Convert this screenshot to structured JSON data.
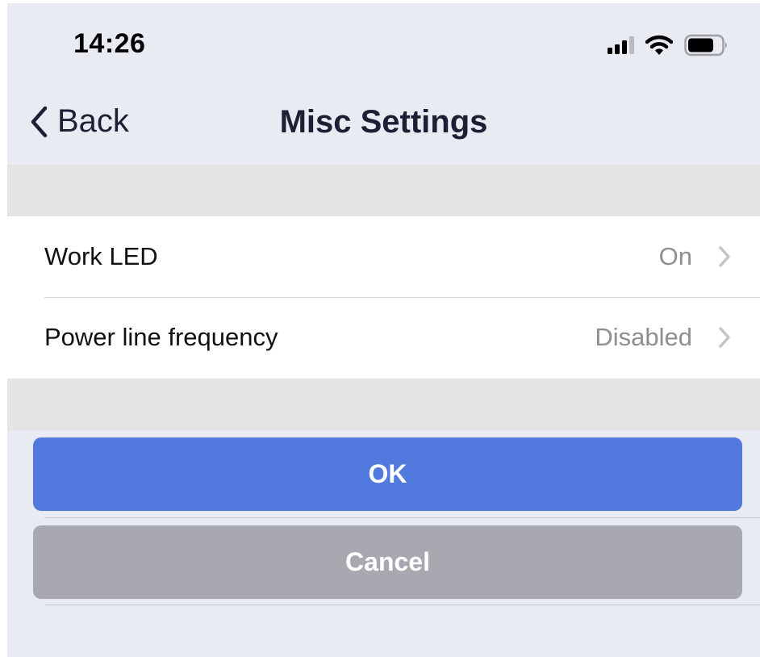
{
  "status_bar": {
    "time": "14:26",
    "icons": [
      "signal-icon",
      "wifi-icon",
      "battery-icon"
    ]
  },
  "nav": {
    "back_label": "Back",
    "title": "Misc Settings"
  },
  "settings": {
    "rows": [
      {
        "label": "Work LED",
        "value": "On"
      },
      {
        "label": "Power line frequency",
        "value": "Disabled"
      }
    ]
  },
  "actions": {
    "ok_label": "OK",
    "cancel_label": "Cancel"
  },
  "colors": {
    "background": "#e9ebf3",
    "ok_button": "#527ade",
    "cancel_button": "#a7a8b0",
    "value_text": "#8e8e93",
    "title_text": "#1c2035"
  }
}
